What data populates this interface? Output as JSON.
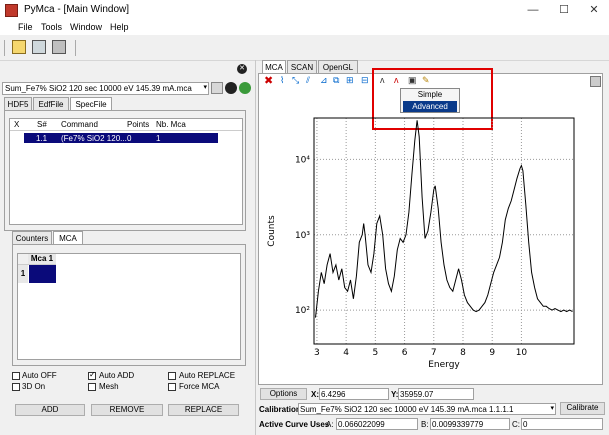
{
  "window": {
    "title": "PyMca - [Main Window]",
    "minimize": "—",
    "maximize": "☐",
    "close": "✕"
  },
  "menu": {
    "file": "File",
    "tools": "Tools",
    "window": "Window",
    "help": "Help"
  },
  "left": {
    "source_file": "Sum_Fe7% SiO2  120 sec 10000 eV 145.39 mA.mca",
    "tabs": [
      "HDF5",
      "EdfFile",
      "SpecFile"
    ],
    "table_headers": [
      "X",
      "S#",
      "Command",
      "Points",
      "Nb. Mca"
    ],
    "table_row": {
      "s": "1.1",
      "command": "(Fe7% SiO2  120...",
      "points": "0",
      "nbmca": "1"
    },
    "sub_tabs": [
      "Counters",
      "MCA"
    ],
    "mca_header": "Mca 1",
    "mca_row": "1",
    "checkboxes": [
      {
        "label": "Auto OFF",
        "checked": false
      },
      {
        "label": "Auto ADD",
        "checked": true
      },
      {
        "label": "Auto REPLACE",
        "checked": false
      },
      {
        "label": "3D On",
        "checked": false
      },
      {
        "label": "Mesh",
        "checked": false
      },
      {
        "label": "Force MCA",
        "checked": false
      }
    ],
    "buttons": {
      "add": "ADD",
      "remove": "REMOVE",
      "replace": "REPLACE"
    }
  },
  "right": {
    "tabs": [
      "MCA",
      "SCAN",
      "OpenGL"
    ],
    "popup": {
      "simple": "Simple",
      "advanced": "Advanced"
    },
    "options_button": "Options",
    "x_label": "X:",
    "x_value": "6.4296",
    "y_label": "Y:",
    "y_value": "35959.07",
    "calibration_label": "Calibration",
    "calibration_value": "Sum_Fe7% SiO2  120 sec 10000 eV 145.39 mA.mca 1.1.1.1",
    "calibrate_button": "Calibrate",
    "active_label": "Active Curve Uses",
    "a_label": "A:",
    "a_value": "0.066022099",
    "b_label": "B:",
    "b_value": "0.0099339779",
    "c_label": "C:",
    "c_value": "0"
  },
  "chart_data": {
    "type": "line",
    "xlabel": "Energy",
    "ylabel": "Counts",
    "xlim": [
      2.9,
      11.8
    ],
    "ylim_log": [
      1.55,
      4.55
    ],
    "x_ticks": [
      3,
      4,
      5,
      6,
      7,
      8,
      9,
      10
    ],
    "y_ticks": [
      {
        "label": "10²",
        "exp": 2
      },
      {
        "label": "10³",
        "exp": 3
      },
      {
        "label": "10⁴",
        "exp": 4
      }
    ],
    "grid": true,
    "color": "#000000",
    "series": [
      {
        "points": [
          [
            2.95,
            1.9
          ],
          [
            3.05,
            2.25
          ],
          [
            3.15,
            2.5
          ],
          [
            3.25,
            2.35
          ],
          [
            3.35,
            2.6
          ],
          [
            3.45,
            2.75
          ],
          [
            3.55,
            2.5
          ],
          [
            3.65,
            2.6
          ],
          [
            3.75,
            2.4
          ],
          [
            3.85,
            2.55
          ],
          [
            3.95,
            2.3
          ],
          [
            4.05,
            2.25
          ],
          [
            4.15,
            2.4
          ],
          [
            4.25,
            2.15
          ],
          [
            4.35,
            2.45
          ],
          [
            4.45,
            2.9
          ],
          [
            4.55,
            3.0
          ],
          [
            4.6,
            3.15
          ],
          [
            4.65,
            3.0
          ],
          [
            4.75,
            2.6
          ],
          [
            4.85,
            2.5
          ],
          [
            4.95,
            2.75
          ],
          [
            5.05,
            3.15
          ],
          [
            5.15,
            3.25
          ],
          [
            5.25,
            3.0
          ],
          [
            5.35,
            2.55
          ],
          [
            5.45,
            2.35
          ],
          [
            5.55,
            2.25
          ],
          [
            5.65,
            2.45
          ],
          [
            5.75,
            2.8
          ],
          [
            5.85,
            2.95
          ],
          [
            5.95,
            2.9
          ],
          [
            6.05,
            3.0
          ],
          [
            6.15,
            3.3
          ],
          [
            6.25,
            3.8
          ],
          [
            6.35,
            4.25
          ],
          [
            6.43,
            4.52
          ],
          [
            6.5,
            4.3
          ],
          [
            6.6,
            3.5
          ],
          [
            6.7,
            2.95
          ],
          [
            6.8,
            3.05
          ],
          [
            6.9,
            3.3
          ],
          [
            7.0,
            3.6
          ],
          [
            7.05,
            3.65
          ],
          [
            7.15,
            3.35
          ],
          [
            7.25,
            2.9
          ],
          [
            7.35,
            2.6
          ],
          [
            7.45,
            2.4
          ],
          [
            7.55,
            2.3
          ],
          [
            7.65,
            2.25
          ],
          [
            7.75,
            2.4
          ],
          [
            7.85,
            2.55
          ],
          [
            7.95,
            2.4
          ],
          [
            8.05,
            2.2
          ],
          [
            8.15,
            2.1
          ],
          [
            8.25,
            2.05
          ],
          [
            8.35,
            2.0
          ],
          [
            8.45,
            1.98
          ],
          [
            8.55,
            2.0
          ],
          [
            8.65,
            2.05
          ],
          [
            8.75,
            2.1
          ],
          [
            8.85,
            2.2
          ],
          [
            8.95,
            2.35
          ],
          [
            9.05,
            2.5
          ],
          [
            9.15,
            2.6
          ],
          [
            9.25,
            2.7
          ],
          [
            9.35,
            2.9
          ],
          [
            9.45,
            3.2
          ],
          [
            9.55,
            3.35
          ],
          [
            9.65,
            3.45
          ],
          [
            9.75,
            3.6
          ],
          [
            9.85,
            3.75
          ],
          [
            9.95,
            3.88
          ],
          [
            10.0,
            3.92
          ],
          [
            10.05,
            3.85
          ],
          [
            10.15,
            3.4
          ],
          [
            10.25,
            2.9
          ],
          [
            10.35,
            2.5
          ],
          [
            10.45,
            2.3
          ],
          [
            10.55,
            2.15
          ],
          [
            10.65,
            2.1
          ],
          [
            10.75,
            2.05
          ],
          [
            10.85,
            2.05
          ],
          [
            10.95,
            2.02
          ],
          [
            11.05,
            2.0
          ],
          [
            11.15,
            2.02
          ],
          [
            11.25,
            2.0
          ],
          [
            11.35,
            1.98
          ],
          [
            11.45,
            2.0
          ],
          [
            11.55,
            1.98
          ],
          [
            11.65,
            2.0
          ],
          [
            11.75,
            1.98
          ]
        ]
      }
    ]
  }
}
